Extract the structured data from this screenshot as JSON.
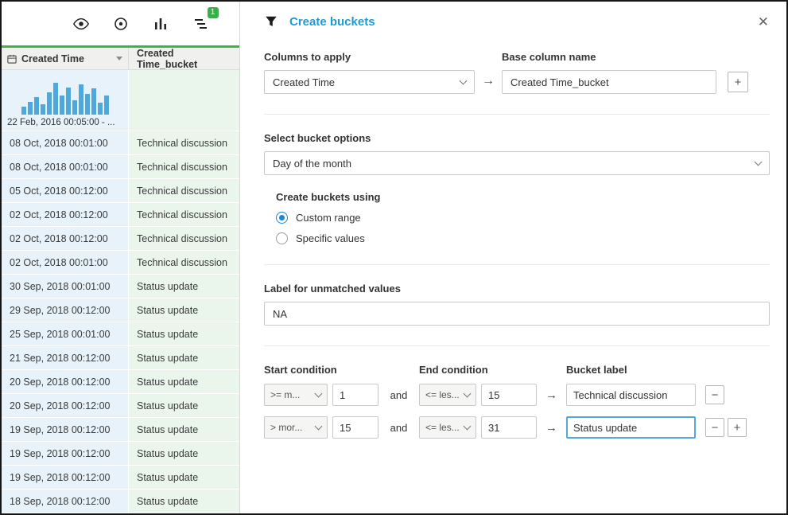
{
  "colors": {
    "accent_blue": "#1a9cd8",
    "badge_green": "#3aae49",
    "time_column_bg": "#e7f2fb",
    "bucket_column_bg": "#eaf6ec",
    "histogram_bar": "#4fa8dc",
    "focus_border": "#55a7e0"
  },
  "left_panel": {
    "toolbar": {
      "badge_count": "1"
    },
    "table": {
      "col_time_header": "Created Time",
      "col_bucket_header": "Created Time_bucket",
      "histogram": {
        "bars": [
          10,
          16,
          22,
          13,
          28,
          40,
          24,
          34,
          18,
          38,
          26,
          33,
          15,
          24
        ],
        "range_label": "22 Feb, 2016 00:05:00 - ..."
      },
      "rows": [
        {
          "time": "08 Oct, 2018 00:01:00",
          "bucket": "Technical discussion"
        },
        {
          "time": "08 Oct, 2018 00:01:00",
          "bucket": "Technical discussion"
        },
        {
          "time": "05 Oct, 2018 00:12:00",
          "bucket": "Technical discussion"
        },
        {
          "time": "02 Oct, 2018 00:12:00",
          "bucket": "Technical discussion"
        },
        {
          "time": "02 Oct, 2018 00:12:00",
          "bucket": "Technical discussion"
        },
        {
          "time": "02 Oct, 2018 00:01:00",
          "bucket": "Technical discussion"
        },
        {
          "time": "30 Sep, 2018 00:01:00",
          "bucket": "Status update"
        },
        {
          "time": "29 Sep, 2018 00:12:00",
          "bucket": "Status update"
        },
        {
          "time": "25 Sep, 2018 00:01:00",
          "bucket": "Status update"
        },
        {
          "time": "21 Sep, 2018 00:12:00",
          "bucket": "Status update"
        },
        {
          "time": "20 Sep, 2018 00:12:00",
          "bucket": "Status update"
        },
        {
          "time": "20 Sep, 2018 00:12:00",
          "bucket": "Status update"
        },
        {
          "time": "19 Sep, 2018 00:12:00",
          "bucket": "Status update"
        },
        {
          "time": "19 Sep, 2018 00:12:00",
          "bucket": "Status update"
        },
        {
          "time": "19 Sep, 2018 00:12:00",
          "bucket": "Status update"
        },
        {
          "time": "18 Sep, 2018 00:12:00",
          "bucket": "Status update"
        }
      ]
    }
  },
  "dialog": {
    "title": "Create buckets",
    "close_glyph": "✕",
    "arrow_glyph": "→",
    "add_glyph": "+",
    "remove_glyph": "−",
    "columns_to_apply_label": "Columns to apply",
    "column_select_value": "Created Time",
    "base_column_label": "Base column name",
    "base_column_value": "Created Time_bucket",
    "bucket_options_label": "Select bucket options",
    "bucket_options_value": "Day of the month",
    "create_buckets_using_label": "Create buckets using",
    "radios": [
      {
        "label": "Custom range",
        "selected": true
      },
      {
        "label": "Specific values",
        "selected": false
      }
    ],
    "unmatched_label": "Label for unmatched values",
    "unmatched_value": "NA",
    "conditions": {
      "start_header": "Start condition",
      "end_header": "End condition",
      "bucket_header": "Bucket label",
      "and_label": "and",
      "rows": [
        {
          "start_op": ">= m...",
          "start_value": "1",
          "end_op": "<= les...",
          "end_value": "15",
          "bucket_label": "Technical discussion",
          "focused": false
        },
        {
          "start_op": "> mor...",
          "start_value": "15",
          "end_op": "<= les...",
          "end_value": "31",
          "bucket_label": "Status update",
          "focused": true
        }
      ]
    }
  }
}
